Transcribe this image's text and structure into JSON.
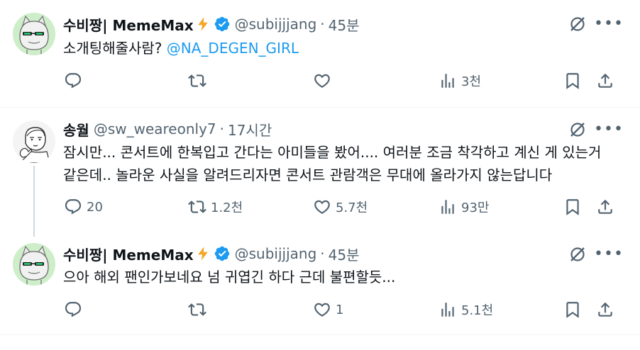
{
  "tweets": [
    {
      "display_name": "수비짱| MemeMax",
      "emoji": "⚡",
      "handle": "@subijjjang",
      "sep": "·",
      "time": "45분",
      "text": "소개팅해줄사람? ",
      "mention": "@NA_DEGEN_GIRL",
      "replies": "",
      "retweets": "",
      "likes": "",
      "views": "3천"
    },
    {
      "display_name": "송월",
      "handle": "@sw_weareonly7",
      "sep": "·",
      "time": "17시간",
      "text_line1": "잠시만... 콘서트에 한복입고 간다는 아미들을 봤어.... 여러분 조금 착각하고 계신 게 있는거",
      "text_line2": "같은데.. 놀라운 사실을 알려드리자면 콘서트 관람객은 무대에 올라가지 않는답니다",
      "replies": "20",
      "retweets": "1.2천",
      "likes": "5.7천",
      "views": "93만"
    },
    {
      "display_name": "수비짱| MemeMax",
      "emoji": "⚡",
      "handle": "@subijjjang",
      "sep": "·",
      "time": "45분",
      "text": "으아 해외 팬인가보네요 넘 귀엽긴 하다 근데 불편할듯...",
      "replies": "",
      "retweets": "",
      "likes": "1",
      "views": "5.1천"
    }
  ],
  "icons": {
    "reply": "reply-icon",
    "retweet": "retweet-icon",
    "like": "like-icon",
    "views": "views-icon",
    "bookmark": "bookmark-icon",
    "share": "share-icon",
    "grok": "grok-icon",
    "more": "more-icon",
    "verified": "verified-badge-icon"
  },
  "colors": {
    "text": "#0f1419",
    "secondary": "#536471",
    "mention": "#1d9bf0",
    "verified": "#1d9bf0",
    "emoji": "#f5a623"
  }
}
